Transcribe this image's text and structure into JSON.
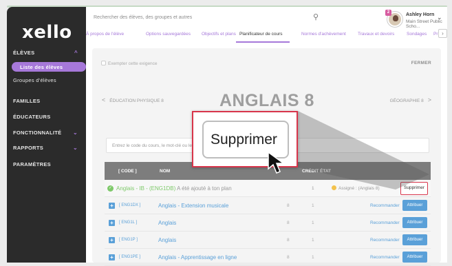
{
  "sidebar": {
    "logo": "xello",
    "items": [
      {
        "label": "ÉLÈVES",
        "chevron": "^"
      },
      {
        "label": "Liste des élèves"
      },
      {
        "label": "Groupes d'élèves"
      },
      {
        "label": "FAMILLES"
      },
      {
        "label": "ÉDUCATEURS"
      },
      {
        "label": "FONCTIONNALITÉ",
        "chevron": "⌄"
      },
      {
        "label": "RAPPORTS",
        "chevron": "⌄"
      },
      {
        "label": "PARAMÈTRES"
      }
    ],
    "accent_color": "#a678d9"
  },
  "header": {
    "search_placeholder": "Rechercher des élèves, des groupes et autres",
    "badge_count": "2",
    "user_name": "Ashley Horn",
    "school": "Main Street Public Scho..."
  },
  "tabs": [
    {
      "label": "À propos de l'élève"
    },
    {
      "label": "Options sauvegardées"
    },
    {
      "label": "Objectifs et plans"
    },
    {
      "label": "Planificateur de cours"
    },
    {
      "label": "Normes d'achèvement"
    },
    {
      "label": "Travaux et devoirs"
    },
    {
      "label": "Sondages"
    },
    {
      "label": "Pr"
    }
  ],
  "panel": {
    "exempt_label": "Exempter cette exigence",
    "close_label": "FERMER",
    "prev_label": "ÉDUCATION PHYSIQUE 8",
    "subject_title": "ANGLAIS 8",
    "next_label": "GÉOGRAPHIE 8",
    "code_placeholder": "Entrez le code du cours, le mot-clé ou le n"
  },
  "table": {
    "headers": {
      "code": "[ CODE ]",
      "name": "NOM",
      "credit": "CRÉDIT",
      "state": "ÉTAT"
    },
    "added_row": {
      "name": "Anglais - IB - (ENG1DB)",
      "rest": "A été ajouté à ton plan",
      "credit": "1",
      "state": "Assigné : (Anglais 8)",
      "button": "Supprimer"
    },
    "rows": [
      {
        "code": "[ ENG1DX ]",
        "name": "Anglais - Extension musicale",
        "grade": "8",
        "credit": "1",
        "rec": "Recommander",
        "btn": "Attribuer"
      },
      {
        "code": "[ ENG1L ]",
        "name": "Anglais",
        "grade": "8",
        "credit": "1",
        "rec": "Recommander",
        "btn": "Attribuer"
      },
      {
        "code": "[ ENG1P ]",
        "name": "Anglais",
        "grade": "8",
        "credit": "1",
        "rec": "Recommander",
        "btn": "Attribuer"
      },
      {
        "code": "[ ENG1PE ]",
        "name": "Anglais - Apprentissage en ligne",
        "grade": "8",
        "credit": "1",
        "rec": "Recommander",
        "btn": "Attribuer"
      }
    ]
  },
  "zoom_callout": {
    "label": "Supprimer",
    "border_color": "#d8344a"
  }
}
